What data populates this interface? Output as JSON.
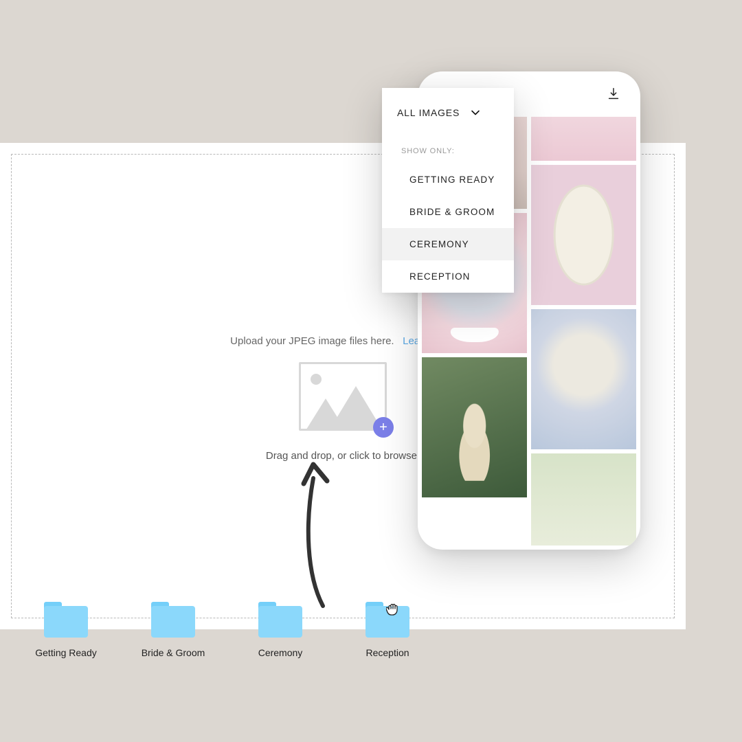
{
  "upload": {
    "headline": "Upload your JPEG image files here.",
    "learn_more": "Learn more",
    "drag_text": "Drag and drop, or click to browse."
  },
  "folders": [
    {
      "label": "Getting Ready"
    },
    {
      "label": "Bride & Groom"
    },
    {
      "label": "Ceremony"
    },
    {
      "label": "Reception"
    }
  ],
  "dropdown": {
    "selected": "ALL IMAGES",
    "subtitle": "SHOW ONLY:",
    "items": [
      {
        "label": "GETTING READY",
        "active": false
      },
      {
        "label": "BRIDE & GROOM",
        "active": false
      },
      {
        "label": "CEREMONY",
        "active": true
      },
      {
        "label": "RECEPTION",
        "active": false
      }
    ]
  },
  "icons": {
    "plus": "+",
    "download": "download-icon",
    "chevron_down": "chevron-down-icon",
    "grab_cursor": "grab-cursor-icon"
  }
}
